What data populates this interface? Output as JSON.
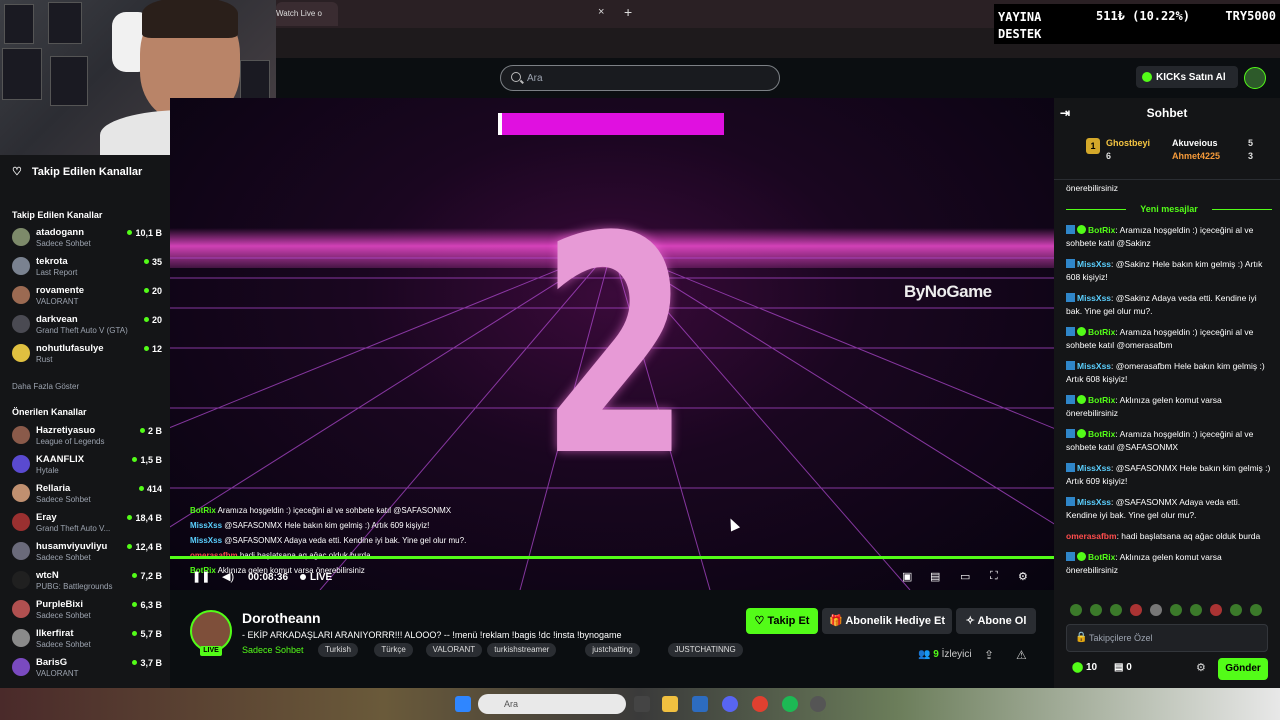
{
  "browser": {
    "tab_title": "Watch Live o",
    "tab_close": "×",
    "new_tab": "+"
  },
  "stream_overlay": {
    "label_line1": "YAYINA",
    "label_line2": "DESTEK",
    "value": "511₺ (10.22%)",
    "currency_total": "TRY5000"
  },
  "header": {
    "search_placeholder": "Ara",
    "kicks_button": "KICKs Satın Al"
  },
  "sidebar": {
    "heading": "Takip Edilen Kanallar",
    "followed_title": "Takip Edilen Kanallar",
    "followed": [
      {
        "name": "atadogann",
        "category": "Sadece Sohbet",
        "viewers": "10,1 B",
        "color": "#7d8a6a"
      },
      {
        "name": "tekrota",
        "category": "Last Report",
        "viewers": "35",
        "color": "#7a8290"
      },
      {
        "name": "rovamente",
        "category": "VALORANT",
        "viewers": "20",
        "color": "#9b6a52"
      },
      {
        "name": "darkvean",
        "category": "Grand Theft Auto V (GTA)",
        "viewers": "20",
        "color": "#4a4a52"
      },
      {
        "name": "nohutlufasulye",
        "category": "Rust",
        "viewers": "12",
        "color": "#e0c040"
      }
    ],
    "show_more": "Daha Fazla Göster",
    "recommended_title": "Önerilen Kanallar",
    "recommended": [
      {
        "name": "Hazretiyasuo",
        "category": "League of Legends",
        "viewers": "2 B",
        "color": "#8a5a4a"
      },
      {
        "name": "KAANFLIX",
        "category": "Hytale",
        "viewers": "1,5 B",
        "color": "#5a4ad0"
      },
      {
        "name": "Rellaria",
        "category": "Sadece Sohbet",
        "viewers": "414",
        "color": "#c09070"
      },
      {
        "name": "Eray",
        "category": "Grand Theft Auto V...",
        "viewers": "18,4 B",
        "color": "#9a3030"
      },
      {
        "name": "husamviyuvliyu",
        "category": "Sadece Sohbet",
        "viewers": "12,4 B",
        "color": "#6a6a7a"
      },
      {
        "name": "wtcN",
        "category": "PUBG: Battlegrounds",
        "viewers": "7,2 B",
        "color": "#202020"
      },
      {
        "name": "PurpleBixi",
        "category": "Sadece Sohbet",
        "viewers": "6,3 B",
        "color": "#b05050"
      },
      {
        "name": "Ilkerfirat",
        "category": "Sadece Sohbet",
        "viewers": "5,7 B",
        "color": "#8a8a8a"
      },
      {
        "name": "BarisG",
        "category": "VALORANT",
        "viewers": "3,7 B",
        "color": "#7a4ac0"
      }
    ]
  },
  "video": {
    "countdown": "2",
    "brand": "ByNoGame",
    "overlay_chat": [
      {
        "user": "BotRix",
        "text": "Aramıza hoşgeldin :) içeceğini al ve sohbete katıl @SAFASONMX",
        "color": "#53fc18"
      },
      {
        "user": "MissXss",
        "text": "@SAFASONMX Hele bakın kim gelmiş :) Artık 609 kişiyiz!",
        "color": "#5bd0ff"
      },
      {
        "user": "MissXss",
        "text": "@SAFASONMX Adaya veda etti. Kendine iyi bak. Yine gel olur mu?.",
        "color": "#5bd0ff"
      },
      {
        "user": "omerasafbm",
        "text": "hadi başlatsana aq ağac olduk burda",
        "color": "#ff4d4d"
      },
      {
        "user": "BotRix",
        "text": "Aklınıza gelen komut varsa önerebilirsiniz",
        "color": "#53fc18"
      }
    ],
    "time": "00:08:36",
    "live_label": "LIVE"
  },
  "channel": {
    "name": "Dorotheann",
    "live_badge": "LIVE",
    "title": "- EKİP ARKADAŞLARI ARANIYORRR!!! ALOOO? -- !menü !reklam !bagis !dc !insta !bynogame",
    "category": "Sadece Sohbet",
    "tags": [
      "Turkish",
      "Türkçe",
      "VALORANT",
      "turkishstreamer",
      "justchatting",
      "JUSTCHATINNG"
    ],
    "follow_button": "Takip Et",
    "gift_button": "Abonelik Hediye Et",
    "subscribe_button": "Abone Ol",
    "viewers_count": "9",
    "viewers_label": "İzleyici"
  },
  "chat": {
    "title": "Sohbet",
    "leaderboard": [
      {
        "name": "Ghostbeyi",
        "count": "6",
        "rank": "1"
      },
      {
        "name": "Akuveious",
        "count": "5"
      },
      {
        "name": "Ahmet4225",
        "count": "3"
      }
    ],
    "pre_text": "önerebilirsiniz",
    "new_messages_label": "Yeni mesajlar",
    "messages": [
      {
        "user": "BotRix",
        "kind": "bot",
        "text": "Aramıza hoşgeldin :) içeceğini al ve sohbete katıl @Sakinz"
      },
      {
        "user": "MissXss",
        "kind": "miss",
        "text": "@Sakinz Hele bakın kim gelmiş :) Artık 608 kişiyiz!"
      },
      {
        "user": "MissXss",
        "kind": "miss",
        "text": "@Sakinz Adaya veda etti. Kendine iyi bak. Yine gel olur mu?."
      },
      {
        "user": "BotRix",
        "kind": "bot",
        "text": "Aramıza hoşgeldin :) içeceğini al ve sohbete katıl @omerasafbm"
      },
      {
        "user": "MissXss",
        "kind": "miss",
        "text": "@omerasafbm Hele bakın kim gelmiş :) Artık 608 kişiyiz!"
      },
      {
        "user": "BotRix",
        "kind": "bot",
        "text": "Aklınıza gelen komut varsa önerebilirsiniz"
      },
      {
        "user": "BotRix",
        "kind": "bot",
        "text": "Aramıza hoşgeldin :) içeceğini al ve sohbete katıl @SAFASONMX"
      },
      {
        "user": "MissXss",
        "kind": "miss",
        "text": "@SAFASONMX Hele bakın kim gelmiş :) Artık 609 kişiyiz!"
      },
      {
        "user": "MissXss",
        "kind": "miss",
        "text": "@SAFASONMX Adaya veda etti. Kendine iyi bak. Yine gel olur mu?."
      },
      {
        "user": "omerasafbm",
        "kind": "ome",
        "text": "hadi başlatsana aq ağac olduk burda"
      },
      {
        "user": "BotRix",
        "kind": "bot",
        "text": "Aklınıza gelen komut varsa önerebilirsiniz"
      }
    ],
    "input_placeholder": "Takipçilere Özel",
    "points": "10",
    "gifts": "0",
    "send_button": "Gönder"
  },
  "taskbar": {
    "search_placeholder": "Ara"
  }
}
